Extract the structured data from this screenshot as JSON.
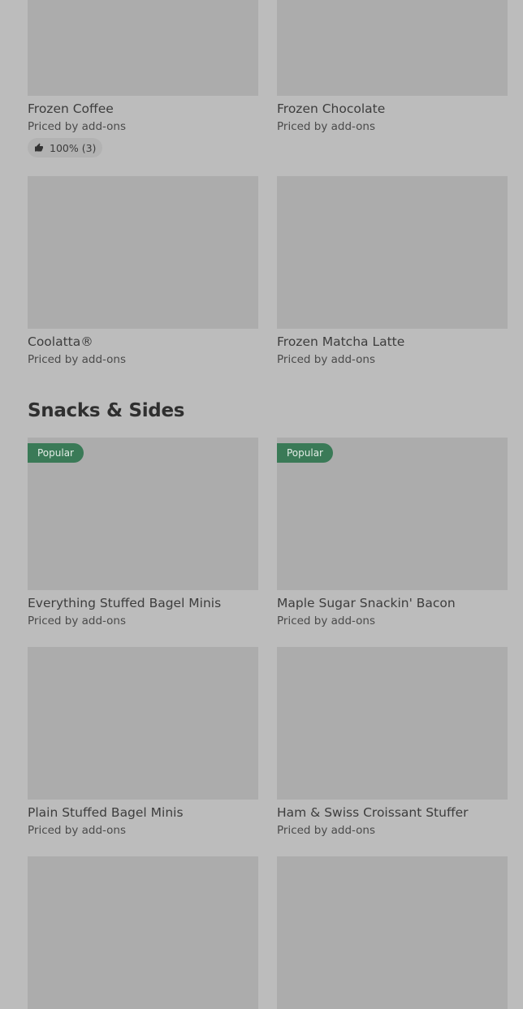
{
  "items": {
    "frozen_coffee": {
      "name": "Frozen Coffee",
      "price": "Priced by add-ons",
      "rating": "100% (3)"
    },
    "frozen_chocolate": {
      "name": "Frozen Chocolate",
      "price": "Priced by add-ons"
    },
    "coolatta": {
      "name": "Coolatta®",
      "price": "Priced by add-ons"
    },
    "frozen_matcha": {
      "name": "Frozen Matcha Latte",
      "price": "Priced by add-ons"
    },
    "everything_bagel": {
      "name": "Everything Stuffed Bagel Minis",
      "price": "Priced by add-ons",
      "badge": "Popular"
    },
    "maple_bacon": {
      "name": "Maple Sugar Snackin' Bacon",
      "price": "Priced by add-ons",
      "badge": "Popular"
    },
    "plain_bagel": {
      "name": "Plain Stuffed Bagel Minis",
      "price": "Priced by add-ons"
    },
    "ham_swiss": {
      "name": "Ham & Swiss Croissant Stuffer",
      "price": "Priced by add-ons"
    }
  },
  "sections": {
    "snacks": {
      "title": "Snacks & Sides"
    }
  },
  "colors": {
    "background": "#bcbcbc",
    "image_placeholder": "#acacac",
    "popular_badge": "#3a7a57"
  },
  "icons": {
    "rating": "thumbs-up-icon"
  }
}
